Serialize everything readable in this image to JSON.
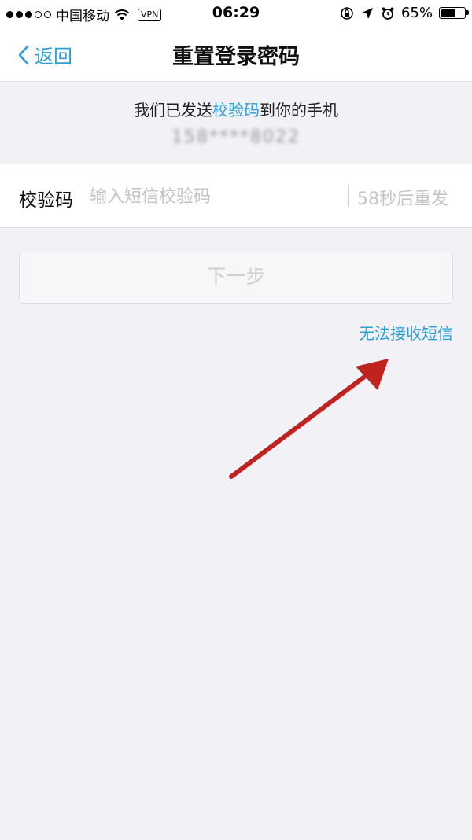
{
  "status_bar": {
    "carrier": "中国移动",
    "vpn": "VPN",
    "time": "06:29",
    "battery": "65%",
    "battery_level": 0.65
  },
  "nav": {
    "back_label": "返回",
    "title": "重置登录密码"
  },
  "info": {
    "prefix": "我们已发送",
    "highlight": "校验码",
    "suffix": "到你的手机",
    "phone": "158****8022"
  },
  "form": {
    "code_label": "校验码",
    "code_placeholder": "输入短信校验码",
    "code_value": "",
    "resend": "58秒后重发"
  },
  "next_button": "下一步",
  "sms_link": "无法接收短信",
  "colors": {
    "accent": "#2a9fd8",
    "background": "#f2f2f6",
    "arrow": "#c0221f"
  }
}
